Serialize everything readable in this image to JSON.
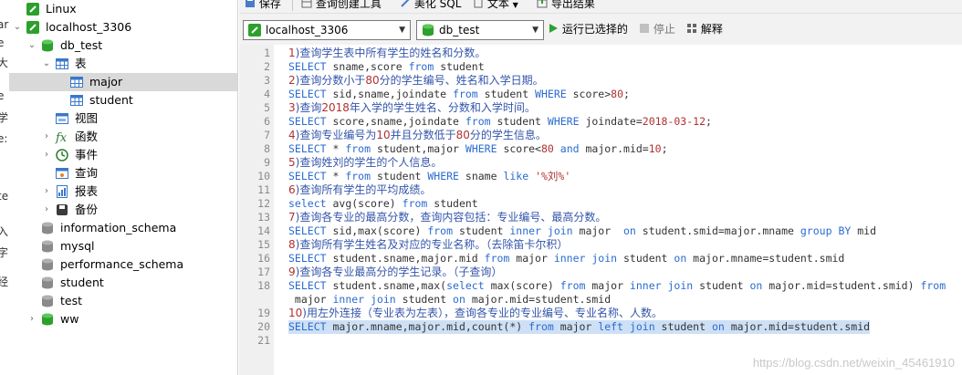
{
  "left_strip": {
    "fragments": [
      "ar",
      "e",
      "大",
      "e",
      "学",
      "e:",
      "",
      "te",
      "入",
      "字",
      "经"
    ]
  },
  "sidebar": {
    "items": [
      {
        "label": "Linux",
        "icon": "connection-icon"
      },
      {
        "label": "localhost_3306",
        "icon": "connection-icon",
        "expanded": true
      },
      {
        "label": "db_test",
        "icon": "database-icon",
        "expanded": true
      },
      {
        "label": "表",
        "icon": "table-folder-icon",
        "expanded": true
      },
      {
        "label": "major",
        "icon": "table-icon",
        "selected": true
      },
      {
        "label": "student",
        "icon": "table-icon"
      },
      {
        "label": "视图",
        "icon": "view-icon"
      },
      {
        "label": "函数",
        "icon": "function-icon"
      },
      {
        "label": "事件",
        "icon": "event-icon"
      },
      {
        "label": "查询",
        "icon": "query-icon"
      },
      {
        "label": "报表",
        "icon": "report-icon"
      },
      {
        "label": "备份",
        "icon": "backup-icon"
      },
      {
        "label": "information_schema",
        "icon": "database-icon"
      },
      {
        "label": "mysql",
        "icon": "database-icon"
      },
      {
        "label": "performance_schema",
        "icon": "database-icon"
      },
      {
        "label": "student",
        "icon": "database-icon"
      },
      {
        "label": "test",
        "icon": "database-icon"
      },
      {
        "label": "ww",
        "icon": "database-icon"
      }
    ]
  },
  "toolbar": {
    "save_label": "保存",
    "query_builder_label": "查询创建工具",
    "beautify_label": "美化 SQL",
    "text_label": "文本",
    "export_label": "导出结果"
  },
  "connbar": {
    "connection_value": "localhost_3306",
    "database_value": "db_test",
    "run_selected_label": "运行已选择的",
    "stop_label": "停止",
    "explain_label": "解释"
  },
  "editor": {
    "lines": [
      {
        "n": "1",
        "text": "1)查询学生表中所有学生的姓名和分数。"
      },
      {
        "n": "2",
        "text": "SELECT sname,score from student"
      },
      {
        "n": "3",
        "text": "2)查询分数小于80分的学生编号、姓名和入学日期。"
      },
      {
        "n": "4",
        "text": "SELECT sid,sname,joindate from student WHERE score>80;"
      },
      {
        "n": "5",
        "text": "3)查询2018年入学的学生姓名、分数和入学时间。"
      },
      {
        "n": "6",
        "text": "SELECT score,sname,joindate from student WHERE joindate=2018-03-12;"
      },
      {
        "n": "7",
        "text": "4)查询专业编号为10并且分数低于80分的学生信息。"
      },
      {
        "n": "8",
        "text": "SELECT * from student,major WHERE score<80 and major.mid=10;"
      },
      {
        "n": "9",
        "text": "5)查询姓刘的学生的个人信息。"
      },
      {
        "n": "10",
        "text": "SELECT * from student WHERE sname like '%刘%'"
      },
      {
        "n": "11",
        "text": "6)查询所有学生的平均成绩。"
      },
      {
        "n": "12",
        "text": "select avg(score) from student"
      },
      {
        "n": "13",
        "text": "7)查询各专业的最高分数，查询内容包括：专业编号、最高分数。"
      },
      {
        "n": "14",
        "text": "SELECT sid,max(score) from student inner join major  on student.smid=major.mname group BY mid"
      },
      {
        "n": "15",
        "text": "8)查询所有学生姓名及对应的专业名称。（去除笛卡尔积）"
      },
      {
        "n": "16",
        "text": "SELECT student.sname,major.mid from major inner join student on major.mname=student.smid"
      },
      {
        "n": "17",
        "text": "9)查询各专业最高分的学生记录。（子查询）"
      },
      {
        "n": "18",
        "text": "SELECT student.sname,max(select max(score) from major inner join student on major.mid=student.smid) from"
      },
      {
        "n": "",
        "text": " major inner join student on major.mid=student.smid"
      },
      {
        "n": "19",
        "text": "10)用左外连接（专业表为左表），查询各专业的专业编号、专业名称、人数。"
      },
      {
        "n": "20",
        "text": "SELECT major.mname,major.mid,count(*) from major left join student on major.mid=student.smid"
      },
      {
        "n": "21",
        "text": ""
      }
    ]
  },
  "watermark": "https://blog.csdn.net/weixin_45461910",
  "colors": {
    "keyword": "#2a6bd0",
    "comment": "#3355aa",
    "string": "#b03030",
    "selection": "#cde0f5",
    "run_icon": "#2ca02c",
    "db_icon": "#2ca02c"
  }
}
